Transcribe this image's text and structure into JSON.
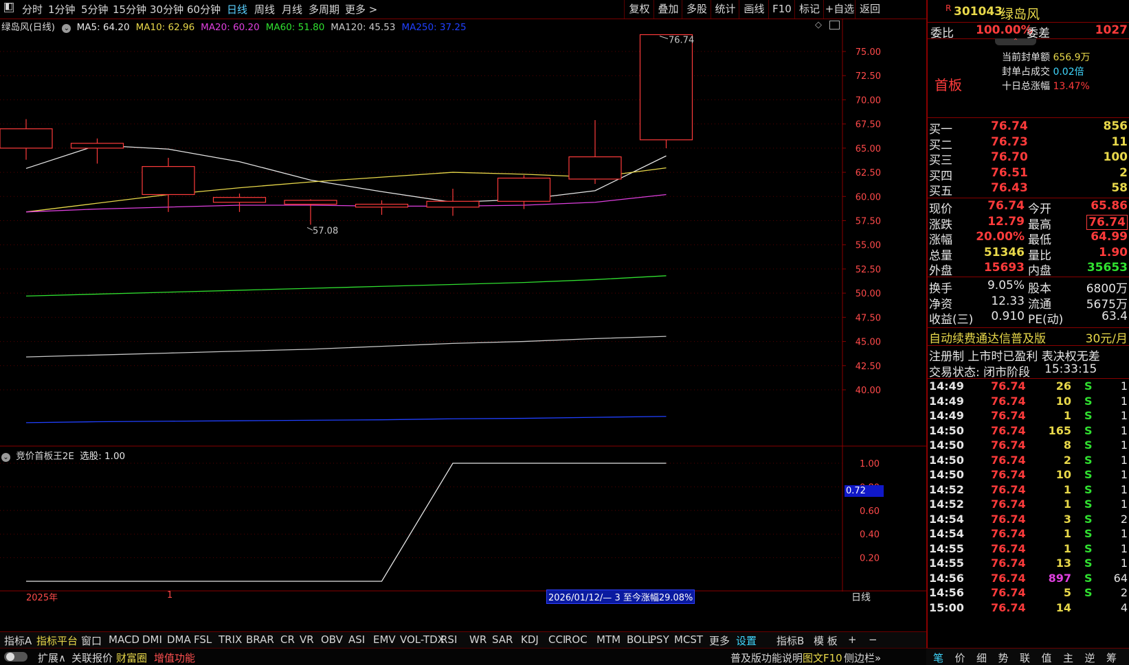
{
  "toolbar": {
    "periods": [
      "分时",
      "1分钟",
      "5分钟",
      "15分钟",
      "30分钟",
      "60分钟",
      "日线",
      "周线",
      "月线",
      "多周期",
      "更多 >"
    ],
    "active_period": "日线",
    "tools": [
      "复权",
      "叠加",
      "多股",
      "统计",
      "画线",
      "F10",
      "标记",
      "+自选",
      "返回"
    ]
  },
  "legend": {
    "stock_label": "绿岛风(日线)",
    "ma": [
      {
        "label": "MA5: 64.20",
        "color": "#e6e6e6"
      },
      {
        "label": "MA10: 62.96",
        "color": "#e8d84a"
      },
      {
        "label": "MA20: 60.20",
        "color": "#e040e0"
      },
      {
        "label": "MA60: 51.80",
        "color": "#30e030"
      },
      {
        "label": "MA120: 45.53",
        "color": "#c8c8c8"
      },
      {
        "label": "MA250: 37.25",
        "color": "#2040ff"
      }
    ]
  },
  "chart_data": [
    {
      "type": "candlestick",
      "title": "绿岛风(日线)",
      "ylim": [
        38.5,
        77.5
      ],
      "yticks": [
        "75.00",
        "72.50",
        "70.00",
        "67.50",
        "65.00",
        "62.50",
        "60.00",
        "57.50",
        "55.00",
        "52.50",
        "50.00",
        "47.50",
        "45.00",
        "42.50",
        "40.00"
      ],
      "candles": [
        {
          "open": 65.0,
          "high": 68.0,
          "low": 63.8,
          "close": 67.0
        },
        {
          "open": 65.0,
          "high": 66.0,
          "low": 63.4,
          "close": 65.5
        },
        {
          "open": 60.2,
          "high": 64.0,
          "low": 58.4,
          "close": 63.1
        },
        {
          "open": 59.4,
          "high": 60.3,
          "low": 58.4,
          "close": 59.9
        },
        {
          "open": 59.2,
          "high": 59.7,
          "low": 57.08,
          "close": 59.6
        },
        {
          "open": 58.9,
          "high": 59.6,
          "low": 58.1,
          "close": 59.2
        },
        {
          "open": 58.9,
          "high": 60.8,
          "low": 58.0,
          "close": 59.5
        },
        {
          "open": 59.5,
          "high": 62.2,
          "low": 58.7,
          "close": 61.9
        },
        {
          "open": 61.8,
          "high": 67.9,
          "low": 61.3,
          "close": 64.1
        },
        {
          "open": 65.86,
          "high": 76.74,
          "low": 64.99,
          "close": 76.74
        }
      ],
      "annotations": [
        "57.08",
        "76.74"
      ],
      "ma_lines": [
        {
          "name": "MA5",
          "color": "#e6e6e6",
          "values": [
            62.9,
            65.3,
            64.9,
            63.6,
            61.7,
            60.5,
            59.4,
            59.7,
            60.6,
            64.2
          ]
        },
        {
          "name": "MA10",
          "color": "#e8d84a",
          "values": [
            58.4,
            59.3,
            60.2,
            60.9,
            61.5,
            62.0,
            62.5,
            62.3,
            62.0,
            62.96
          ]
        },
        {
          "name": "MA20",
          "color": "#e040e0",
          "values": [
            58.4,
            58.7,
            58.9,
            59.1,
            59.1,
            59.0,
            59.0,
            59.1,
            59.4,
            60.2
          ]
        },
        {
          "name": "MA60",
          "color": "#30e030",
          "values": [
            49.7,
            49.9,
            50.1,
            50.3,
            50.5,
            50.7,
            50.9,
            51.1,
            51.4,
            51.8
          ]
        },
        {
          "name": "MA120",
          "color": "#c8c8c8",
          "values": [
            43.4,
            43.6,
            43.8,
            44.0,
            44.2,
            44.5,
            44.8,
            45.0,
            45.3,
            45.53
          ]
        },
        {
          "name": "MA250",
          "color": "#2040ff",
          "values": [
            36.6,
            36.7,
            36.75,
            36.8,
            36.85,
            36.9,
            37.0,
            37.05,
            37.15,
            37.25
          ]
        }
      ]
    },
    {
      "type": "line",
      "title": "竞价首板王2E 选股: 1.00",
      "ylim": [
        0,
        1.1
      ],
      "yticks": [
        "1.00",
        "0.80",
        "0.60",
        "0.40",
        "0.20"
      ],
      "series": [
        {
          "name": "选股",
          "values": [
            0,
            0,
            0,
            0,
            0,
            0,
            1,
            1,
            1,
            1
          ]
        }
      ]
    }
  ],
  "indicator": {
    "label": "竞价首板王2E",
    "value": "选股: 1.00",
    "readout": "0.72"
  },
  "xaxis": {
    "year": "2025年",
    "tick": "1",
    "range_info": "2026/01/12/— 3 至今涨幅29.08%",
    "period_label": "日线"
  },
  "bottom_tabs": [
    "指标A",
    "指标平台",
    "窗口",
    "MACD",
    "DMI",
    "DMA",
    "FSL",
    "TRIX",
    "BRAR",
    "CR",
    "VR",
    "OBV",
    "ASI",
    "EMV",
    "VOL-TDX",
    "RSI",
    "WR",
    "SAR",
    "KDJ",
    "CCI",
    "ROC",
    "MTM",
    "BOLL",
    "PSY",
    "MCST",
    "更多",
    "设置",
    "指标B",
    "模 板",
    "+",
    "−"
  ],
  "status_bar": {
    "expand": "扩展∧",
    "related": "关联报价",
    "wealth": "财富圈",
    "addon": "增值功能",
    "help": "普及版功能说明",
    "f10": "图文F10",
    "sidebar": "侧边栏»"
  },
  "right_panel": {
    "badge": "R",
    "code": "301043",
    "name": "绿岛风",
    "weibi_label": "委比",
    "weibi": "100.00%",
    "weicha_label": "委差",
    "weicha": "1027",
    "board": "首板",
    "seal_amount_label": "当前封单额",
    "seal_amount": "656.9万",
    "seal_ratio_label": "封单占成交",
    "seal_ratio": "0.02倍",
    "ten_day_label": "十日总涨幅",
    "ten_day": "13.47%",
    "bids": [
      {
        "label": "买一",
        "price": "76.74",
        "vol": "856"
      },
      {
        "label": "买二",
        "price": "76.73",
        "vol": "11"
      },
      {
        "label": "买三",
        "price": "76.70",
        "vol": "100"
      },
      {
        "label": "买四",
        "price": "76.51",
        "vol": "2"
      },
      {
        "label": "买五",
        "price": "76.43",
        "vol": "58"
      }
    ],
    "quote": [
      {
        "l1": "现价",
        "v1": "76.74",
        "l2": "今开",
        "v2": "65.86"
      },
      {
        "l1": "涨跌",
        "v1": "12.79",
        "l2": "最高",
        "v2": "76.74"
      },
      {
        "l1": "涨幅",
        "v1": "20.00%",
        "l2": "最低",
        "v2": "64.99"
      },
      {
        "l1": "总量",
        "v1": "51346",
        "l2": "量比",
        "v2": "1.90"
      },
      {
        "l1": "外盘",
        "v1": "15693",
        "l2": "内盘",
        "v2": "35653"
      }
    ],
    "fund": [
      {
        "l1": "换手",
        "v1": "9.05%",
        "l2": "股本",
        "v2": "6800万"
      },
      {
        "l1": "净资",
        "v1": "12.33",
        "l2": "流通",
        "v2": "5675万"
      },
      {
        "l1": "收益(三)",
        "v1": "0.910",
        "l2": "PE(动)",
        "v2": "63.4"
      }
    ],
    "promo": "自动续费通达信普及版",
    "promo_price": "30元/月",
    "reg_info": "注册制 上市时已盈利 表决权无差",
    "trade_status": "交易状态: 闭市阶段",
    "trade_time": "15:33:15",
    "ticks": [
      {
        "t": "14:49",
        "p": "76.74",
        "v": "26",
        "s": "S",
        "n": "1"
      },
      {
        "t": "14:49",
        "p": "76.74",
        "v": "10",
        "s": "S",
        "n": "1"
      },
      {
        "t": "14:49",
        "p": "76.74",
        "v": "1",
        "s": "S",
        "n": "1"
      },
      {
        "t": "14:50",
        "p": "76.74",
        "v": "165",
        "s": "S",
        "n": "1"
      },
      {
        "t": "14:50",
        "p": "76.74",
        "v": "8",
        "s": "S",
        "n": "1"
      },
      {
        "t": "14:50",
        "p": "76.74",
        "v": "2",
        "s": "S",
        "n": "1"
      },
      {
        "t": "14:50",
        "p": "76.74",
        "v": "10",
        "s": "S",
        "n": "1"
      },
      {
        "t": "14:52",
        "p": "76.74",
        "v": "1",
        "s": "S",
        "n": "1"
      },
      {
        "t": "14:52",
        "p": "76.74",
        "v": "1",
        "s": "S",
        "n": "1"
      },
      {
        "t": "14:54",
        "p": "76.74",
        "v": "3",
        "s": "S",
        "n": "2"
      },
      {
        "t": "14:54",
        "p": "76.74",
        "v": "1",
        "s": "S",
        "n": "1"
      },
      {
        "t": "14:55",
        "p": "76.74",
        "v": "1",
        "s": "S",
        "n": "1"
      },
      {
        "t": "14:55",
        "p": "76.74",
        "v": "13",
        "s": "S",
        "n": "1"
      },
      {
        "t": "14:56",
        "p": "76.74",
        "v": "897",
        "s": "S",
        "n": "64"
      },
      {
        "t": "14:56",
        "p": "76.74",
        "v": "5",
        "s": "S",
        "n": "2"
      },
      {
        "t": "15:00",
        "p": "76.74",
        "v": "14",
        "s": "",
        "n": "4"
      }
    ],
    "bottom_tabs": [
      "笔",
      "价",
      "细",
      "势",
      "联",
      "值",
      "主",
      "逆",
      "筹"
    ]
  },
  "colors": {
    "up": "#ff3b3b",
    "down": "#40ffff",
    "grid": "#8a0000",
    "axis_text": "#ff4a4a"
  }
}
